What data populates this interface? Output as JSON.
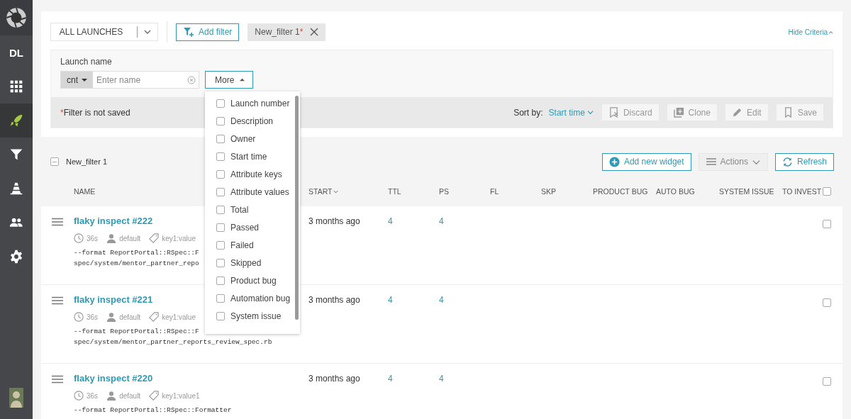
{
  "sidebar": {
    "items": [
      {
        "kind": "project",
        "label": "DL",
        "selected": false
      },
      {
        "kind": "dashboards",
        "selected": false
      },
      {
        "kind": "launches",
        "selected": true
      },
      {
        "kind": "filters",
        "selected": false
      },
      {
        "kind": "debug",
        "selected": false
      },
      {
        "kind": "members",
        "selected": false
      },
      {
        "kind": "settings",
        "selected": false
      }
    ]
  },
  "filter_bar": {
    "launch_selector": "ALL LAUNCHES",
    "add_filter": "Add filter",
    "filter_tab": {
      "label": "New_filter 1",
      "mark": "*"
    },
    "hide_criteria": "Hide Criteria"
  },
  "criteria": {
    "label": "Launch name",
    "condition": "cnt",
    "placeholder": "Enter name",
    "more": "More",
    "more_menu": [
      {
        "label": "Launch number",
        "checked": false
      },
      {
        "label": "Description",
        "checked": false
      },
      {
        "label": "Owner",
        "checked": false
      },
      {
        "label": "Start time",
        "checked": false
      },
      {
        "label": "Attribute keys",
        "checked": false
      },
      {
        "label": "Attribute values",
        "checked": false
      },
      {
        "label": "Total",
        "checked": false
      },
      {
        "label": "Passed",
        "checked": false
      },
      {
        "label": "Failed",
        "checked": false
      },
      {
        "label": "Skipped",
        "checked": false
      },
      {
        "label": "Product bug",
        "checked": false
      },
      {
        "label": "Automation bug",
        "checked": false
      },
      {
        "label": "System issue",
        "checked": false
      }
    ]
  },
  "filter_footer": {
    "notice_mark": "*",
    "notice": "Filter is not saved",
    "sort_label": "Sort by:",
    "sort_value": "Start time",
    "actions": [
      {
        "kind": "discard",
        "label": "Discard",
        "disabled": true
      },
      {
        "kind": "clone",
        "label": "Clone",
        "disabled": true
      },
      {
        "kind": "edit",
        "label": "Edit",
        "disabled": true
      },
      {
        "kind": "save",
        "label": "Save",
        "disabled": true
      }
    ]
  },
  "launches": {
    "filter_expanded": true,
    "filter_name": "New_filter 1",
    "add_widget": "Add new widget",
    "actions": "Actions",
    "refresh": "Refresh",
    "columns": [
      {
        "label": "NAME",
        "sorted": false
      },
      {
        "label": "START",
        "sorted": true
      },
      {
        "label": "TTL",
        "sorted": false
      },
      {
        "label": "PS",
        "sorted": false
      },
      {
        "label": "FL",
        "sorted": false
      },
      {
        "label": "SKP",
        "sorted": false
      },
      {
        "label": "PRODUCT BUG",
        "sorted": false
      },
      {
        "label": "AUTO BUG",
        "sorted": false
      },
      {
        "label": "SYSTEM ISSUE",
        "sorted": false
      },
      {
        "label": "TO INVEST",
        "sorted": false
      }
    ],
    "all_selected": false,
    "rows": [
      {
        "name": "flaky inspect #222",
        "duration": "36s",
        "owner": "default",
        "attribute": "key1:value",
        "description": [
          "--format ReportPortal::RSpec::F",
          "spec/system/mentor_partner_repo"
        ],
        "start": "3 months ago",
        "total": "4",
        "passed": "4",
        "selected": false
      },
      {
        "name": "flaky inspect #221",
        "duration": "36s",
        "owner": "default",
        "attribute": "key1:value",
        "description": [
          "--format ReportPortal::RSpec::F",
          "spec/system/mentor_partner_reports_review_spec.rb"
        ],
        "start": "3 months ago",
        "total": "4",
        "passed": "4",
        "selected": false
      },
      {
        "name": "flaky inspect #220",
        "duration": "36s",
        "owner": "default",
        "attribute": "key1:value1",
        "description": [
          "--format ReportPortal::RSpec::Formatter"
        ],
        "start": "3 months ago",
        "total": "4",
        "passed": "4",
        "selected": false
      }
    ]
  }
}
